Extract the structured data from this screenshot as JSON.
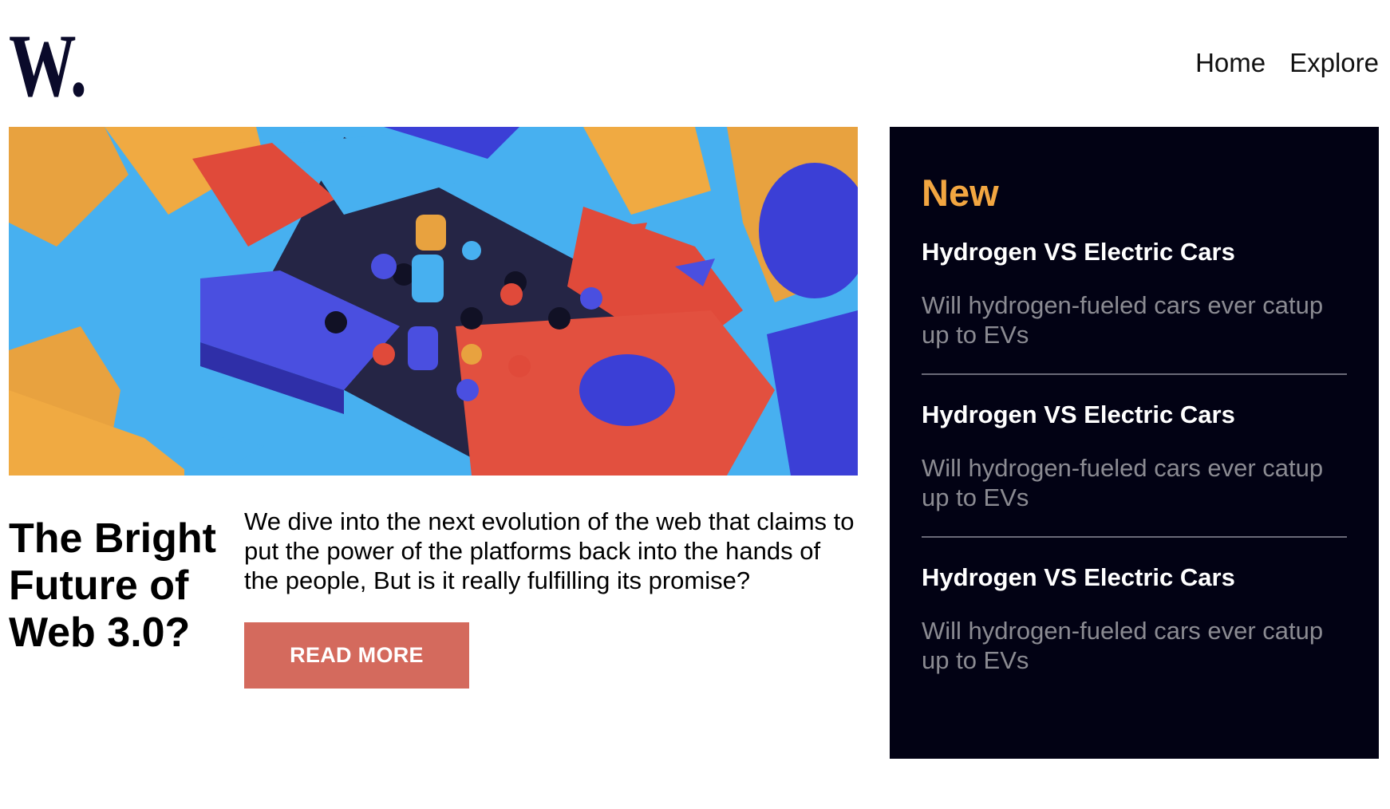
{
  "brand": {
    "logo_text": "W."
  },
  "nav": {
    "items": [
      {
        "label": "Home"
      },
      {
        "label": "Explore"
      }
    ]
  },
  "hero": {
    "headline": "The Bright Future of Web 3.0?",
    "intro": "We dive into the next evolution of the web that claims to put the power of the platforms back into the hands of the people, But is it really fulfilling its promise?",
    "cta_label": "READ MORE"
  },
  "sidebar": {
    "title": "New",
    "items": [
      {
        "title": "Hydrogen VS Electric Cars",
        "description": "Will hydrogen-fueled cars ever catup up to EVs"
      },
      {
        "title": "Hydrogen VS Electric Cars",
        "description": "Will hydrogen-fueled cars ever catup up to EVs"
      },
      {
        "title": "Hydrogen VS Electric Cars",
        "description": "Will hydrogen-fueled cars ever catup up to EVs"
      }
    ]
  },
  "colors": {
    "brand_dark": "#0a0a2a",
    "sidebar_bg": "#020214",
    "accent_orange": "#f2a641",
    "cta_red": "#d46a5d",
    "muted_text": "#8b8b92"
  }
}
